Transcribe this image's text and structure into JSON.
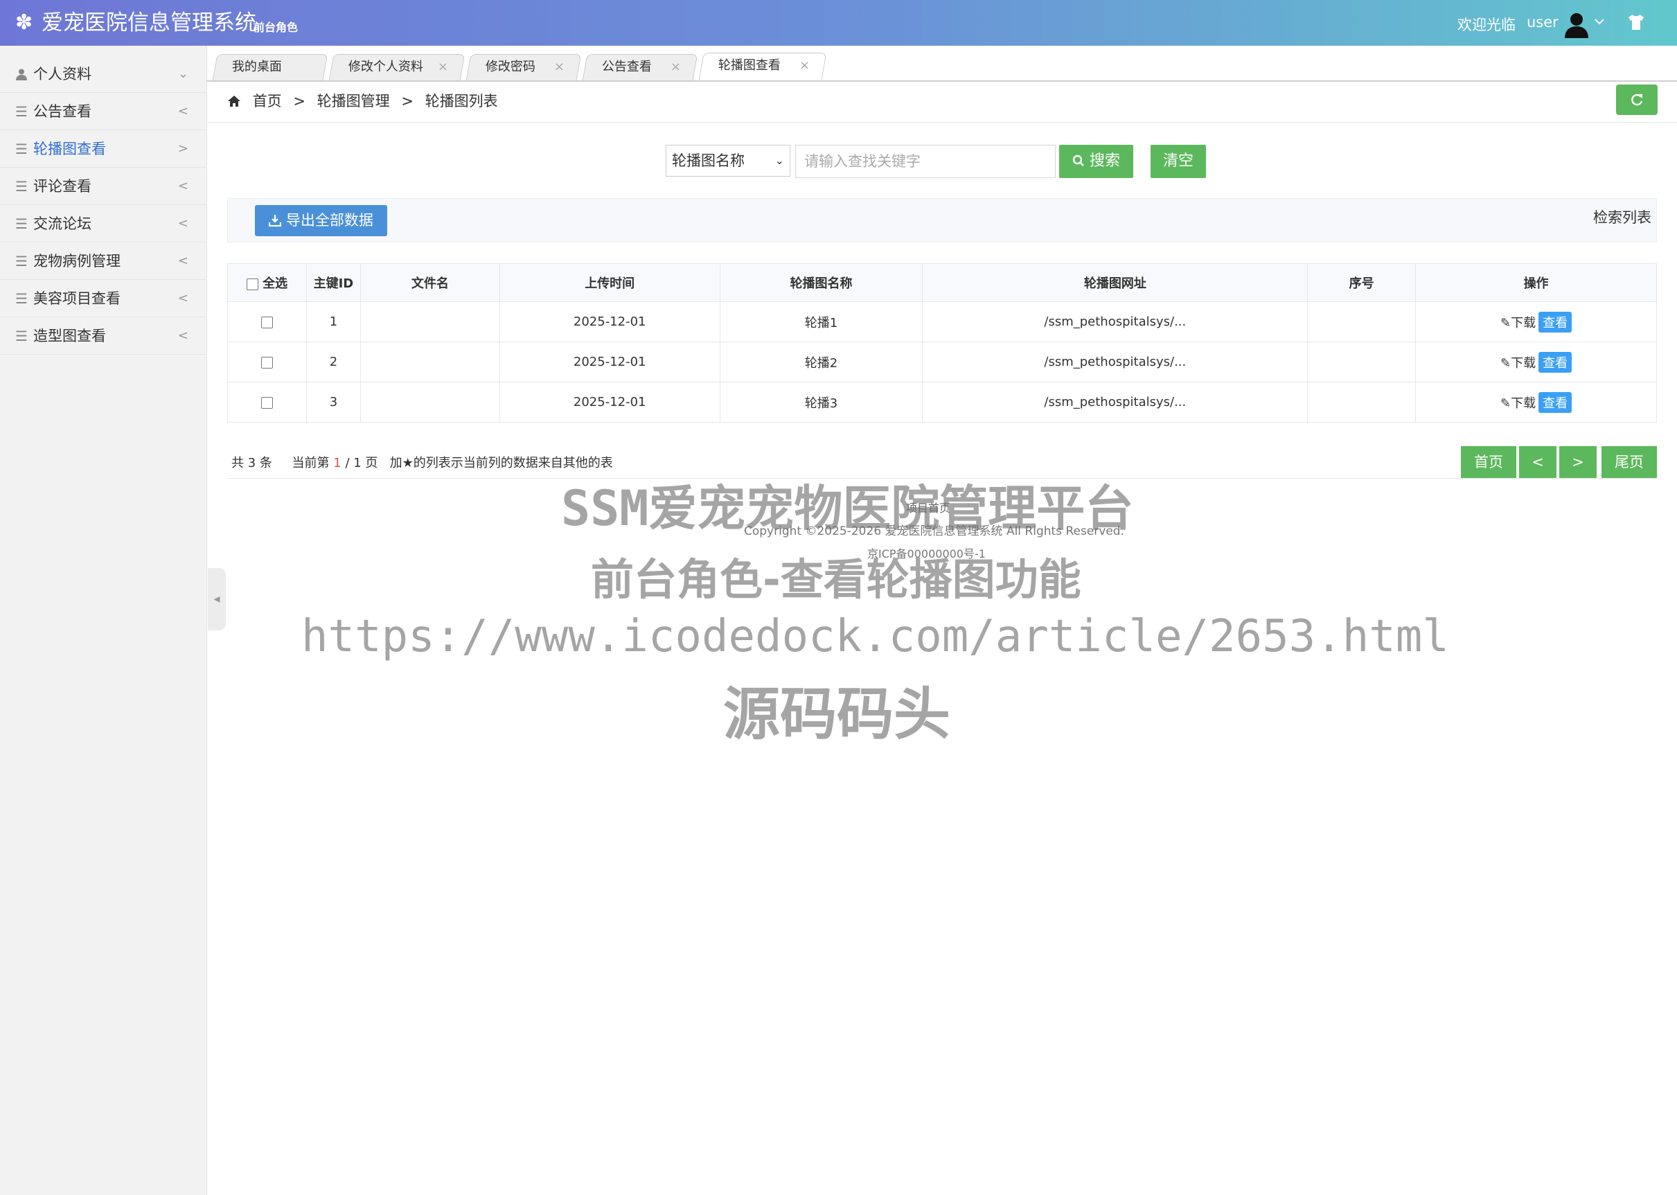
{
  "header": {
    "logo_icon": "gear-icon",
    "title": "爱宠医院信息管理系统",
    "role": "前台角色",
    "welcome": "欢迎光临",
    "username": "user"
  },
  "sidebar": {
    "items": [
      {
        "label": "个人资料",
        "icon": "user-icon",
        "arrow": "chevron-down"
      },
      {
        "label": "公告查看",
        "icon": "menu-icon",
        "arrow": "<"
      },
      {
        "label": "轮播图查看",
        "icon": "menu-icon",
        "arrow": ">",
        "active": true
      },
      {
        "label": "评论查看",
        "icon": "menu-icon",
        "arrow": "<"
      },
      {
        "label": "交流论坛",
        "icon": "menu-icon",
        "arrow": "<"
      },
      {
        "label": "宠物病例管理",
        "icon": "menu-icon",
        "arrow": "<"
      },
      {
        "label": "美容项目查看",
        "icon": "menu-icon",
        "arrow": "<"
      },
      {
        "label": "造型图查看",
        "icon": "menu-icon",
        "arrow": "<"
      }
    ]
  },
  "tabs": [
    {
      "label": "我的桌面",
      "closable": false
    },
    {
      "label": "修改个人资料",
      "closable": true
    },
    {
      "label": "修改密码",
      "closable": true
    },
    {
      "label": "公告查看",
      "closable": true
    },
    {
      "label": "轮播图查看",
      "closable": true,
      "active": true
    }
  ],
  "breadcrumb": {
    "home": "首页",
    "sep": ">",
    "level1": "轮播图管理",
    "level2": "轮播图列表"
  },
  "search": {
    "field_selected": "轮播图名称",
    "placeholder": "请输入查找关键字",
    "search_label": "搜索",
    "clear_label": "清空"
  },
  "toolbar": {
    "export_label": "导出全部数据",
    "list_title": "检索列表"
  },
  "table": {
    "select_all": "全选",
    "columns": [
      "主键ID",
      "文件名",
      "上传时间",
      "轮播图名称",
      "轮播图网址",
      "序号",
      "操作"
    ],
    "rows": [
      {
        "id": "1",
        "filename": "",
        "time": "2025-12-01",
        "name": "轮播1",
        "url": "/ssm_pethospitalsys/...",
        "order": ""
      },
      {
        "id": "2",
        "filename": "",
        "time": "2025-12-01",
        "name": "轮播2",
        "url": "/ssm_pethospitalsys/...",
        "order": ""
      },
      {
        "id": "3",
        "filename": "",
        "time": "2025-12-01",
        "name": "轮播3",
        "url": "/ssm_pethospitalsys/...",
        "order": ""
      }
    ],
    "download_label": "下载",
    "view_label": "查看"
  },
  "pagination": {
    "total_prefix": "共",
    "total": "3",
    "total_suffix": "条",
    "current_prefix": "当前第",
    "current": "1",
    "of": "/ 1 页",
    "note": "加★的列表示当前列的数据来自其他的表",
    "first": "首页",
    "prev": "<",
    "next": ">",
    "last": "尾页"
  },
  "footer": {
    "home_link": "项目首页",
    "copyright": "Copyright ©2025-2026 爱宠医院信息管理系统 All Rights Reserved.",
    "icp": "京ICP备00000000号-1"
  },
  "watermark": {
    "line1": "SSM爱宠宠物医院管理平台",
    "line2": "前台角色-查看轮播图功能",
    "line3": "https://www.icodedock.com/article/2653.html",
    "line4": "源码码头"
  },
  "colors": {
    "header_start": "#6e77d6",
    "header_end": "#62c7cd",
    "green": "#5cb85c",
    "blue": "#4a90d9",
    "view_blue": "#3aa0f5",
    "active_link": "#2e6fd1"
  }
}
